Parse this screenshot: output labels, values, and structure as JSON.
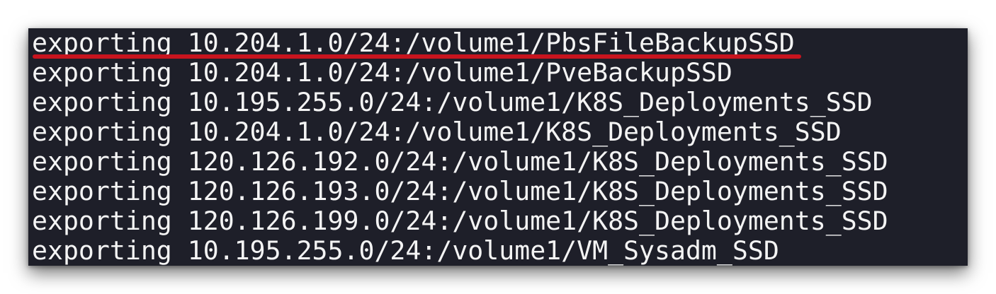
{
  "terminal": {
    "lines": [
      "exporting 10.204.1.0/24:/volume1/PbsFileBackupSSD",
      "exporting 10.204.1.0/24:/volume1/PveBackupSSD",
      "exporting 10.195.255.0/24:/volume1/K8S_Deployments_SSD",
      "exporting 10.204.1.0/24:/volume1/K8S_Deployments_SSD",
      "exporting 120.126.192.0/24:/volume1/K8S_Deployments_SSD",
      "exporting 120.126.193.0/24:/volume1/K8S_Deployments_SSD",
      "exporting 120.126.199.0/24:/volume1/K8S_Deployments_SSD",
      "exporting 10.195.255.0/24:/volume1/VM_Sysadm_SSD"
    ],
    "highlight_color": "#c8141e",
    "background_color": "#1e1f29",
    "text_color": "#f4f4f4"
  }
}
